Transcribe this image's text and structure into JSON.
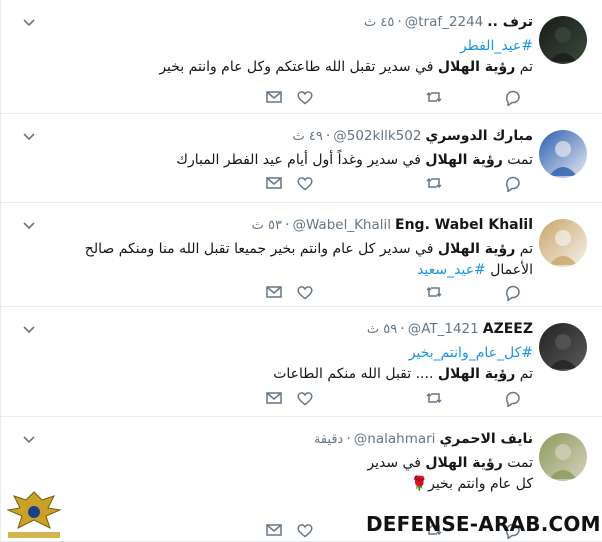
{
  "tweets": [
    {
      "name": "ترف ..",
      "handle": "@traf_2244",
      "time": "٤٥ ث",
      "lines": [
        [
          {
            "t": "#عيد_الفطر",
            "s": "hashtag"
          }
        ],
        [
          {
            "t": "تم ",
            "s": ""
          },
          {
            "t": "رؤية الهلال",
            "s": "bold"
          },
          {
            "t": " في سدير تقبل الله طاعتكم وكل عام وانتم بخير",
            "s": ""
          }
        ]
      ],
      "avatar": {
        "colors": [
          "#1a1a1a",
          "#3a4a3a"
        ],
        "icon": "night-scene-avatar"
      }
    },
    {
      "name": "مبارك الدوسري",
      "handle": "@502kllk502",
      "time": "٤٩ ث",
      "lines": [
        [
          {
            "t": "تمت ",
            "s": ""
          },
          {
            "t": "رؤية الهلال",
            "s": "bold"
          },
          {
            "t": " في سدير وغداً أول أيام عيد الفطر المبارك",
            "s": ""
          }
        ]
      ],
      "avatar": {
        "colors": [
          "#2a5fb0",
          "#e8e8f0"
        ],
        "icon": "team-photo-avatar"
      }
    },
    {
      "name": "Eng. Wabel Khalil",
      "handle": "@Wabel_Khalil",
      "time": "٥٣ ث",
      "lines": [
        [
          {
            "t": "تم ",
            "s": ""
          },
          {
            "t": "رؤية الهلال",
            "s": "bold"
          },
          {
            "t": " في سدير كل عام وانتم بخير جميعا تقبل الله منا ومنكم صالح",
            "s": ""
          }
        ],
        [
          {
            "t": "الأعمال ",
            "s": ""
          },
          {
            "t": "#عيد_سعيد",
            "s": "hashtag"
          }
        ]
      ],
      "avatar": {
        "colors": [
          "#c9a46a",
          "#f4f1ea"
        ],
        "icon": "person-avatar"
      }
    },
    {
      "name": "AZEEZ",
      "handle": "@AT_1421",
      "time": "٥٩ ث",
      "lines": [
        [
          {
            "t": "#كل_عام_وانتم_بخير",
            "s": "hashtag"
          }
        ],
        [
          {
            "t": "تم ",
            "s": ""
          },
          {
            "t": "رؤية الهلال",
            "s": "bold"
          },
          {
            "t": " .... تقبل الله منكم الطاعات",
            "s": ""
          }
        ]
      ],
      "avatar": {
        "colors": [
          "#222222",
          "#5a5a5a"
        ],
        "icon": "dark-logo-avatar"
      }
    },
    {
      "name": "نايف الاحمري",
      "handle": "@nalahmari",
      "time": "دقيقة",
      "lines": [
        [
          {
            "t": "تمت ",
            "s": ""
          },
          {
            "t": "رؤية الهلال",
            "s": "bold"
          },
          {
            "t": " في سدير",
            "s": ""
          }
        ],
        [
          {
            "t": " ",
            "s": ""
          }
        ],
        [
          {
            "t": "كل عام وانتم بخير",
            "s": ""
          },
          {
            "t": "🌹",
            "s": ""
          }
        ]
      ],
      "avatar": {
        "colors": [
          "#8a9a5b",
          "#d8d2c0"
        ],
        "icon": "desert-person-avatar"
      }
    }
  ],
  "watermark": {
    "text": "DEFENSE-ARAB.COM",
    "logo_text": "ARAB DEFENSE FORUM"
  },
  "colors": {
    "link": "#1b95e0",
    "secondary": "#657786",
    "icon": "#657786",
    "divider": "#e6ecf0"
  }
}
